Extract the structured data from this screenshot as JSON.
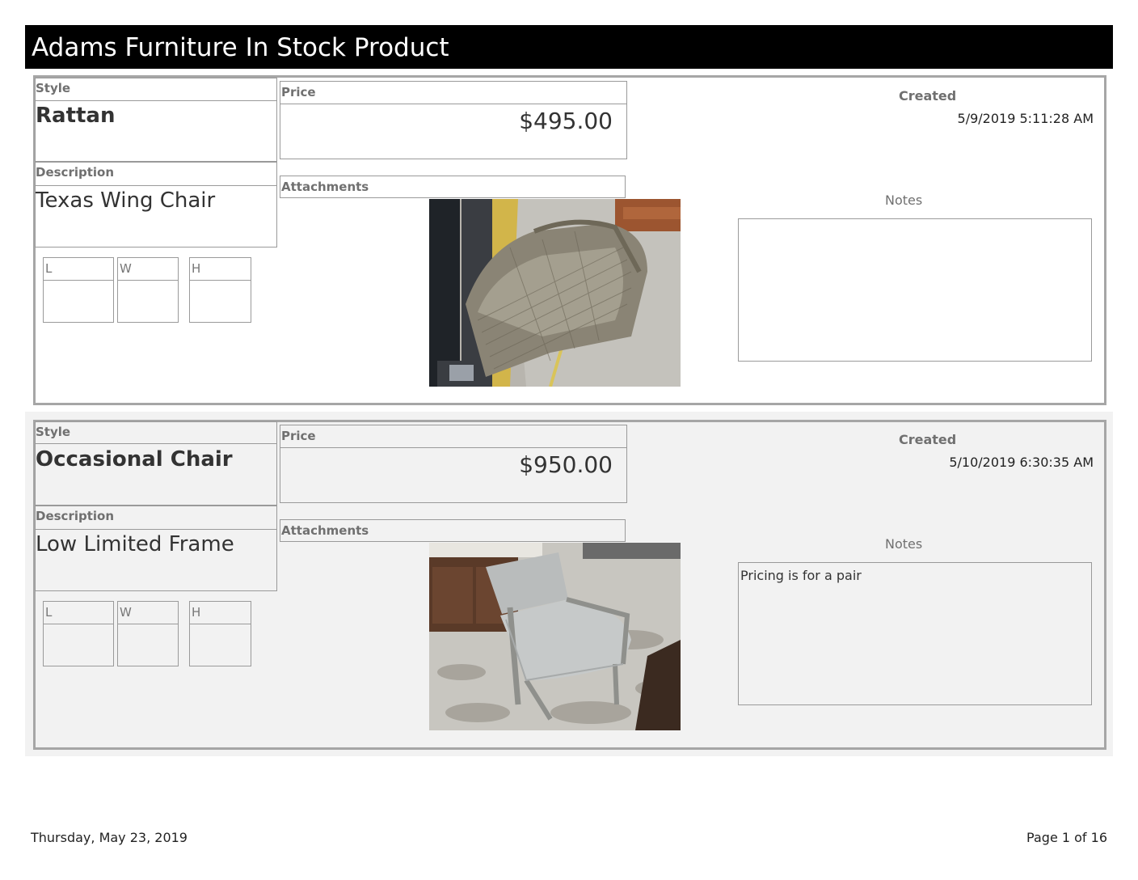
{
  "report": {
    "title": "Adams Furniture In Stock Product"
  },
  "labels": {
    "style": "Style",
    "price": "Price",
    "description": "Description",
    "attachments": "Attachments",
    "length": "L",
    "width": "W",
    "height": "H",
    "created": "Created",
    "notes": "Notes"
  },
  "records": [
    {
      "style": "Rattan",
      "price": "$495.00",
      "description": "Texas Wing Chair",
      "created": "5/9/2019 5:11:28 AM",
      "notes": "",
      "photo_icon": "rattan-wing-chair-photo"
    },
    {
      "style": "Occasional Chair",
      "price": "$950.00",
      "description": "Low Limited Frame",
      "created": "5/10/2019 6:30:35 AM",
      "notes": "Pricing is for a pair",
      "photo_icon": "upholstered-chair-photo"
    }
  ],
  "footer": {
    "date": "Thursday, May 23, 2019",
    "page": "Page 1 of 16"
  }
}
